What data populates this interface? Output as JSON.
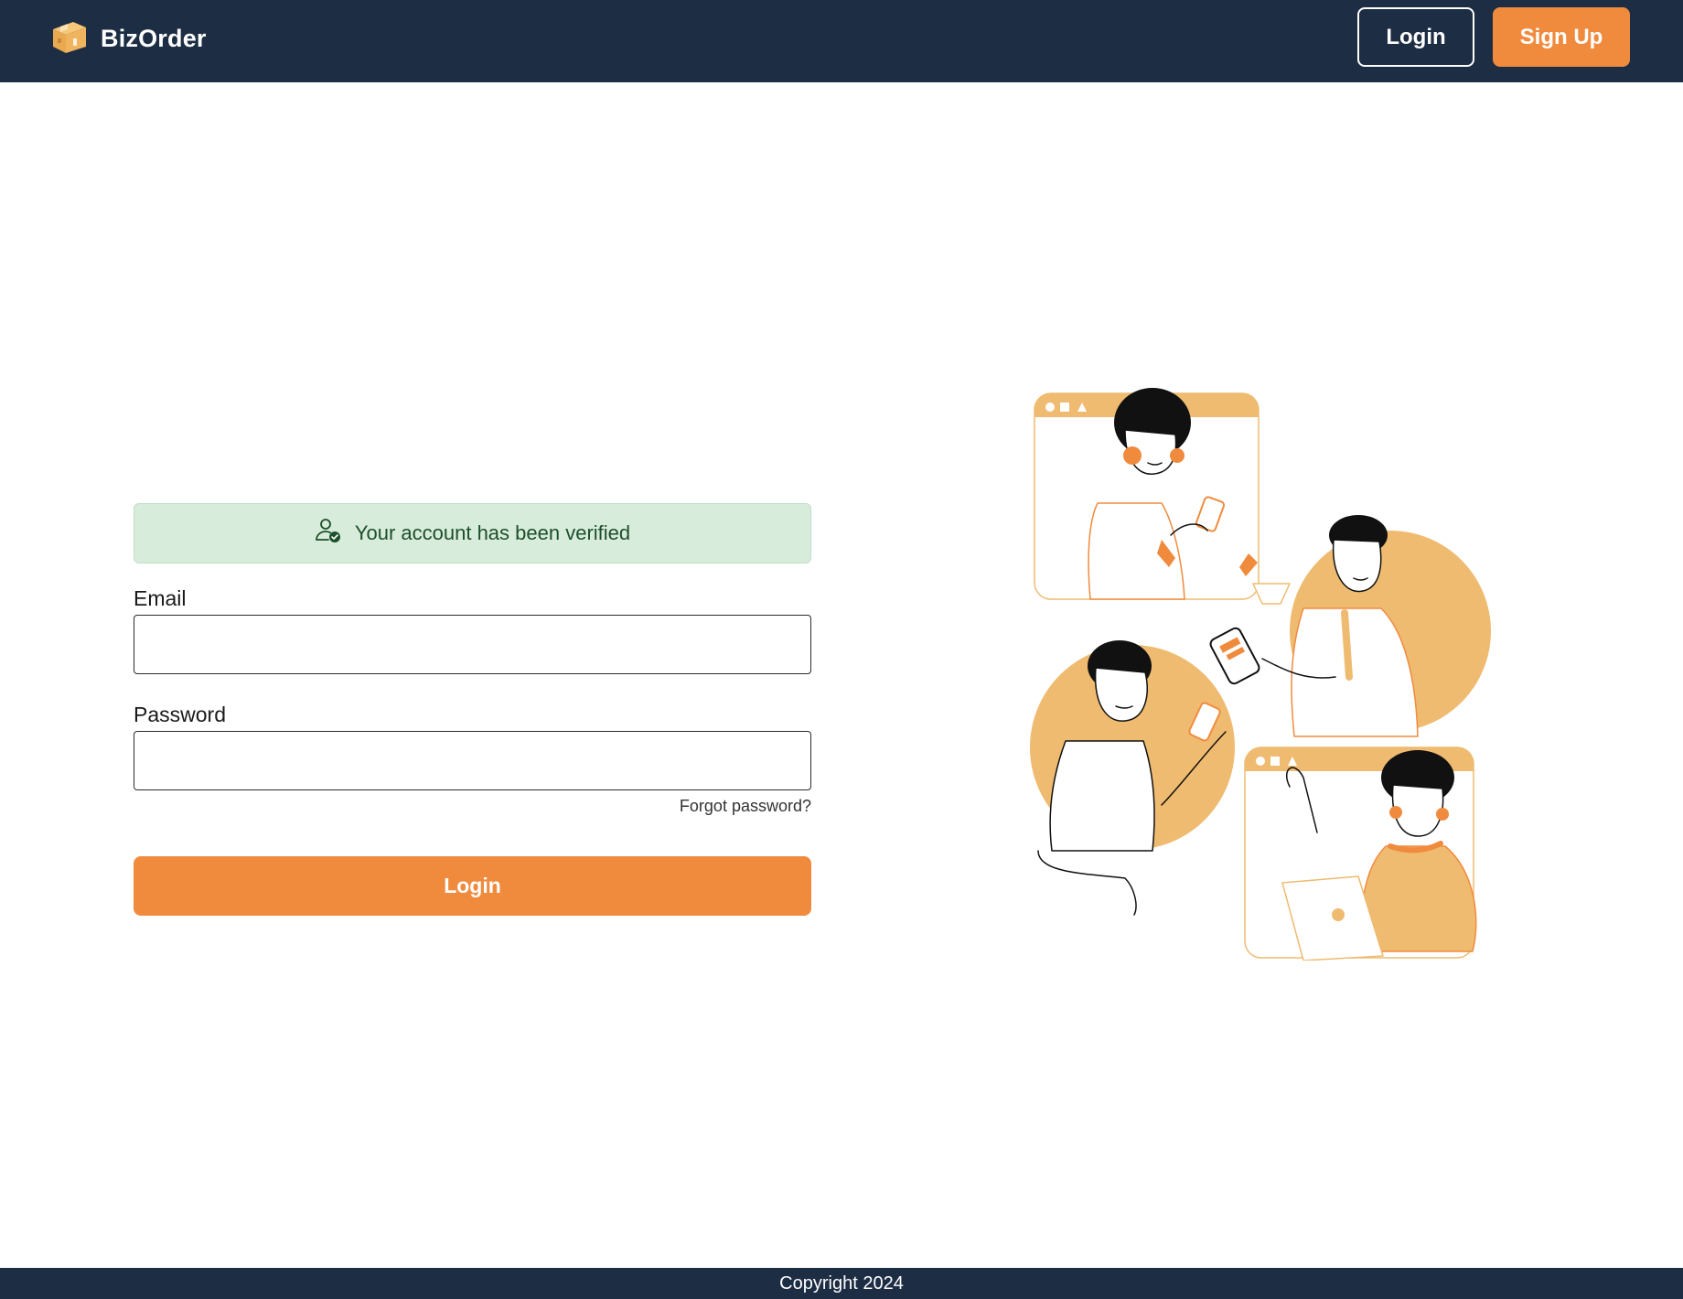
{
  "header": {
    "brand": "BizOrder",
    "login_label": "Login",
    "signup_label": "Sign Up"
  },
  "alert": {
    "message": "Your account has been verified",
    "icon": "user-check-icon"
  },
  "form": {
    "email_label": "Email",
    "email_value": "",
    "password_label": "Password",
    "password_value": "",
    "forgot_label": "Forgot password?",
    "submit_label": "Login"
  },
  "footer": {
    "copyright": "Copyright 2024"
  },
  "colors": {
    "header_bg": "#1d2d44",
    "accent": "#f08b3e",
    "illustration_fill": "#efbb70",
    "alert_bg": "#d8ecdb",
    "alert_text": "#1d4f2a"
  }
}
